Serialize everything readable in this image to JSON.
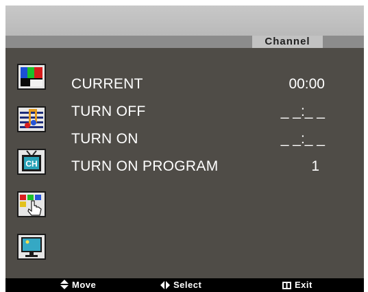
{
  "menu": {
    "title": "Channel",
    "icons": [
      "picture-icon",
      "audio-icon",
      "channel-icon",
      "function-icon",
      "screen-icon"
    ],
    "rows": [
      {
        "label": "CURRENT",
        "value": "00:00"
      },
      {
        "label": "TURN OFF",
        "value": "_ _:_ _"
      },
      {
        "label": "TURN ON",
        "value": "_ _:_ _"
      },
      {
        "label": "TURN ON PROGRAM",
        "value": "1"
      }
    ]
  },
  "footer": {
    "move_label": "Move",
    "select_label": "Select",
    "exit_label": "Exit"
  }
}
